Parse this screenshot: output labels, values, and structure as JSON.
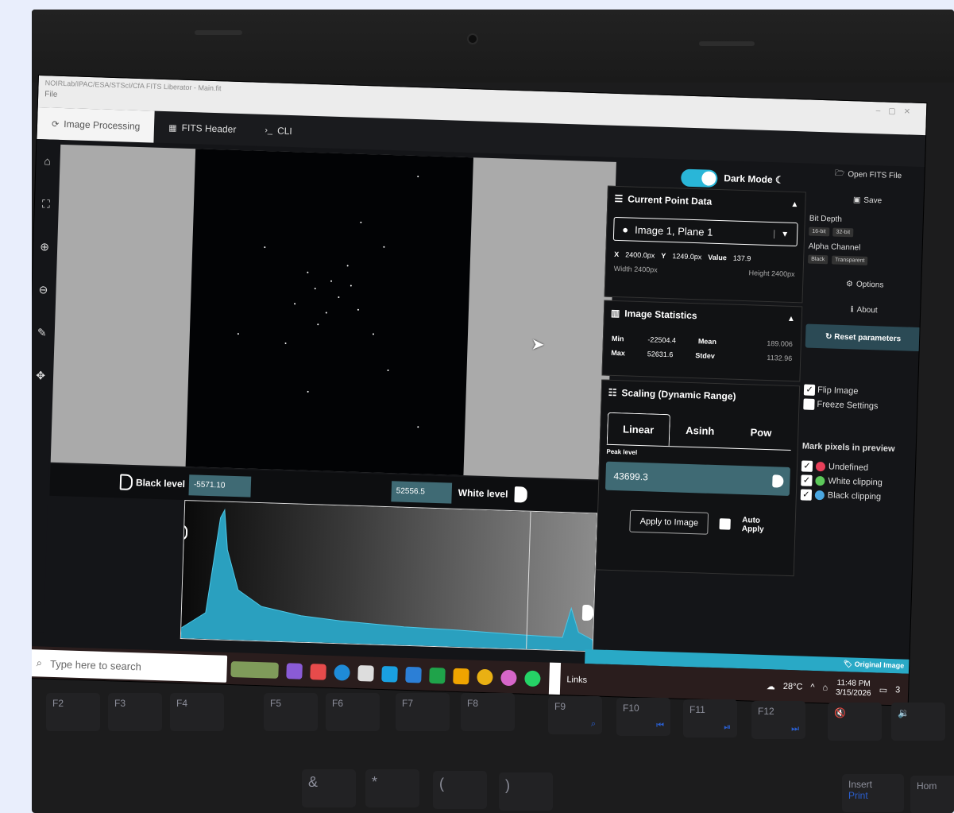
{
  "window": {
    "title": "NOIRLab/IPAC/ESA/STScI/CfA FITS Liberator - Main.fit",
    "menu_file": "File"
  },
  "tabs": [
    {
      "label": "Image Processing",
      "icon": "image-processing-icon"
    },
    {
      "label": "FITS Header",
      "icon": "table-icon"
    },
    {
      "label": "CLI",
      "icon": "terminal-icon"
    }
  ],
  "dark_mode": {
    "label": "Dark Mode",
    "enabled": true
  },
  "levels": {
    "black_label": "Black level",
    "black_value": "-5571.10",
    "white_label": "White level",
    "white_value": "52556.5"
  },
  "current_point": {
    "header": "Current Point Data",
    "selected_plane": "Image 1, Plane 1",
    "x_label": "X",
    "x_value": "2400.0px",
    "y_label": "Y",
    "y_value": "1249.0px",
    "value_label": "Value",
    "value": "137.9",
    "width": "Width 2400px",
    "height": "Height 2400px"
  },
  "statistics": {
    "header": "Image Statistics",
    "min_label": "Min",
    "min": "-22504.4",
    "max_label": "Max",
    "max": "52631.6",
    "mean_label": "Mean",
    "mean": "189.006",
    "stdev_label": "Stdev",
    "stdev": "1132.96"
  },
  "scaling": {
    "header": "Scaling (Dynamic Range)",
    "options": [
      "Linear",
      "Asinh",
      "Pow"
    ],
    "selected": "Linear",
    "peak_label": "Peak level",
    "peak_value": "43699.3",
    "apply_label": "Apply to Image",
    "auto_apply_label": "Auto Apply"
  },
  "sidebar": {
    "open": "Open FITS File",
    "save": "Save",
    "bit_depth": "Bit Depth",
    "bit_16": "16-bit",
    "bit_32": "32-bit",
    "alpha": "Alpha Channel",
    "alpha_black": "Black",
    "alpha_transparent": "Transparent",
    "options": "Options",
    "about": "About",
    "reset": "Reset parameters",
    "flip": "Flip Image",
    "freeze": "Freeze Settings",
    "mark_header": "Mark pixels in preview",
    "undefined": "Undefined",
    "white_clip": "White clipping",
    "black_clip": "Black clipping",
    "colors": {
      "undefined": "#e8405a",
      "white_clip": "#5cc85a",
      "black_clip": "#4aa6e0"
    }
  },
  "original_image_label": "Original Image",
  "taskbar": {
    "search_placeholder": "Type here to search",
    "links": "Links",
    "temp": "28°C",
    "time": "11:48 PM",
    "date": "3/15/2026",
    "notif_count": "3"
  },
  "keyboard": {
    "fkeys": [
      "F2",
      "F3",
      "F4",
      "F5",
      "F6",
      "F7",
      "F8",
      "F9",
      "F10",
      "F11",
      "F12"
    ],
    "row2": [
      "&",
      "*",
      "(",
      ")",
      "Insert",
      "Print",
      "Hom"
    ]
  }
}
